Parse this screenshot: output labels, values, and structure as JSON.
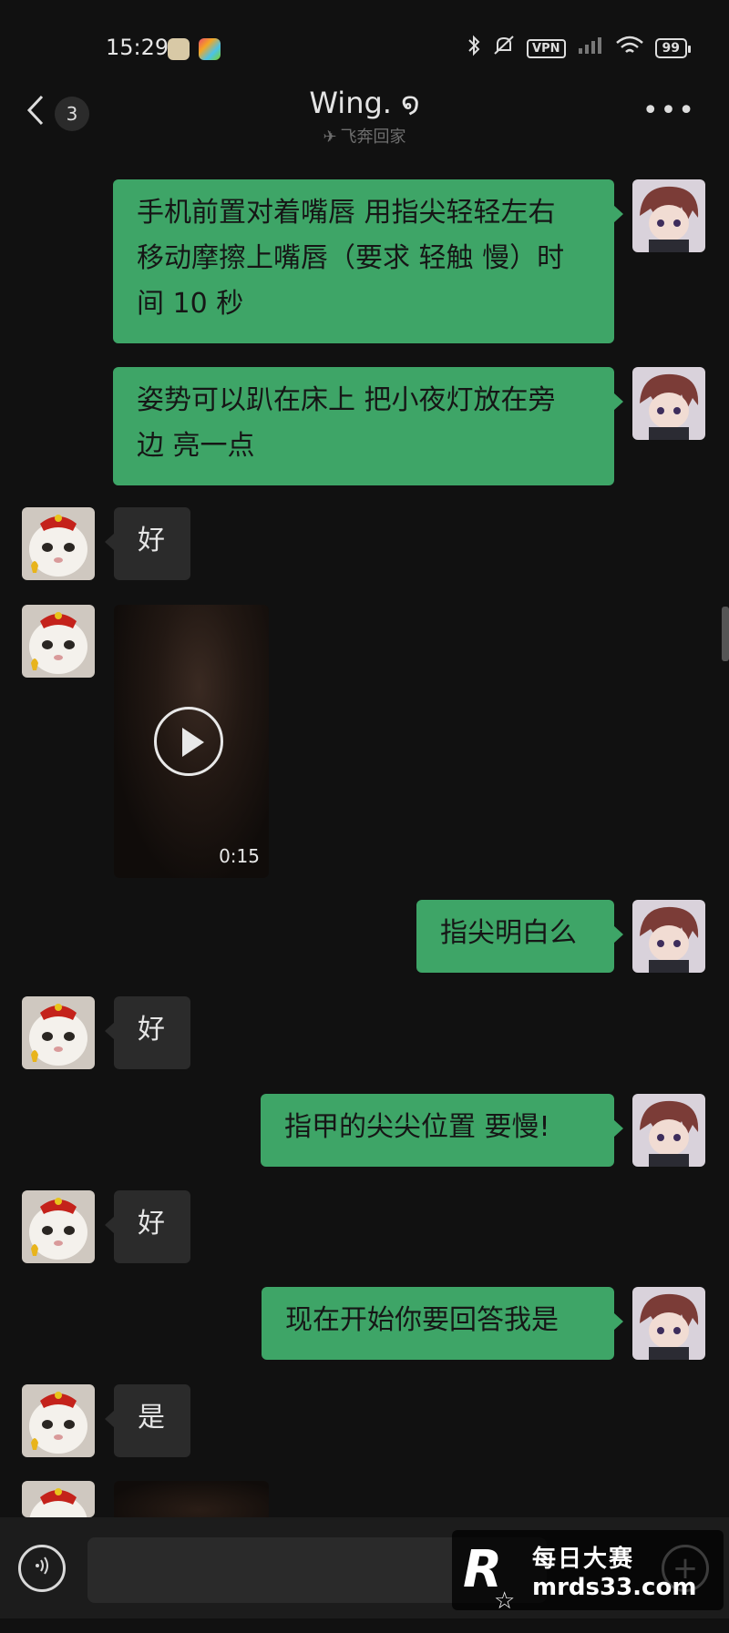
{
  "status_bar": {
    "time": "15:29",
    "vpn": "VPN",
    "battery": "99",
    "icons": [
      "bluetooth-icon",
      "mute-icon",
      "vpn-icon",
      "signal-icon",
      "wifi-icon",
      "battery-icon"
    ]
  },
  "header": {
    "back_icon": "chevron-left-icon",
    "unread_count": "3",
    "title": "Wing. ໑",
    "subtitle": "飞奔回家",
    "more_icon": "more-dots-icon"
  },
  "messages": [
    {
      "sender": "me",
      "type": "text",
      "text": "手机前置对着嘴唇 用指尖轻轻左右\n移动摩擦上嘴唇（要求 轻触 慢）时\n间 10 秒"
    },
    {
      "sender": "me",
      "type": "text",
      "text": "姿势可以趴在床上 把小夜灯放在旁\n边 亮一点"
    },
    {
      "sender": "them",
      "type": "text",
      "text": "好"
    },
    {
      "sender": "them",
      "type": "video",
      "duration": "0:15"
    },
    {
      "sender": "me",
      "type": "text",
      "text": "指尖明白么"
    },
    {
      "sender": "them",
      "type": "text",
      "text": "好"
    },
    {
      "sender": "me",
      "type": "text",
      "text": "指甲的尖尖位置 要慢!"
    },
    {
      "sender": "them",
      "type": "text",
      "text": "好"
    },
    {
      "sender": "me",
      "type": "text",
      "text": "现在开始你要回答我是"
    },
    {
      "sender": "them",
      "type": "text",
      "text": "是"
    }
  ],
  "input_bar": {
    "voice_icon": "voice-icon",
    "input_value": "",
    "plus_icon": "plus-icon"
  },
  "watermark": {
    "logo": "R",
    "name": "每日大赛",
    "url": "mrds33.com"
  },
  "colors": {
    "background": "#111111",
    "my_bubble": "#3ea567",
    "their_bubble": "#2b2b2b"
  }
}
